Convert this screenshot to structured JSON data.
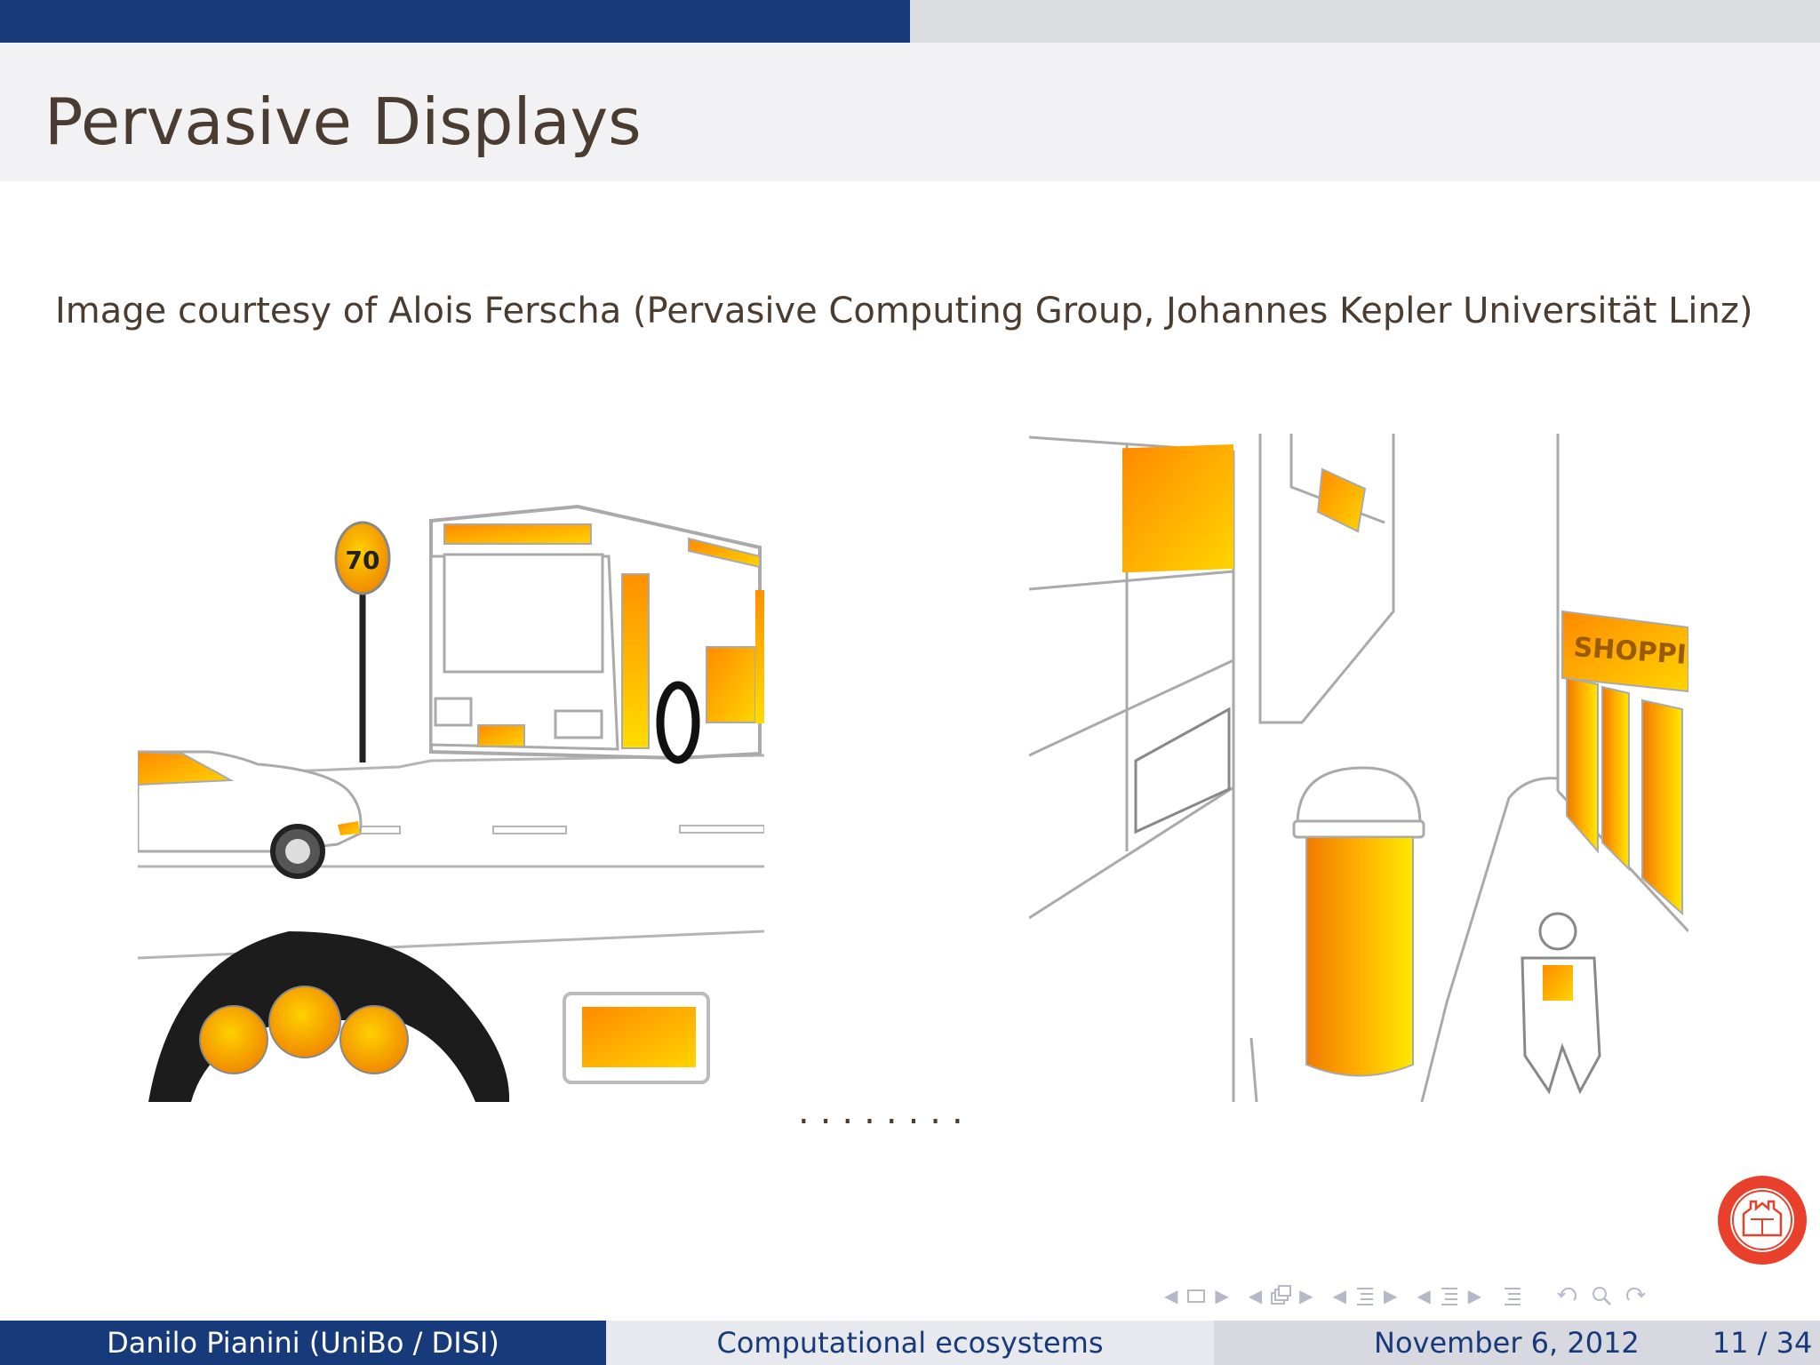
{
  "slide": {
    "title": "Pervasive Displays",
    "caption": "Image courtesy of Alois Ferscha (Pervasive Computing Group, Johannes Kepler Universität Linz)",
    "ellipsis": "........",
    "speed_sign": "70",
    "shop_sign": "SHOPPING",
    "progress_fraction": 0.5
  },
  "footer": {
    "author": "Danilo Pianini  (UniBo / DISI)",
    "talk_title": "Computational ecosystems",
    "date": "November 6, 2012",
    "page": "11 / 34"
  },
  "colors": {
    "navy": "#173a7a",
    "orange": "#f5a000",
    "yellow": "#ffe000",
    "seal_red": "#e8402a",
    "text_brown": "#4a3c30"
  },
  "icons": {
    "logo": "university-seal-icon",
    "nav": [
      "frame-nav-icon",
      "subsection-nav-icon",
      "section-nav-icon",
      "presentation-nav-icon",
      "toc-icon",
      "undo-icon",
      "search-icon",
      "redo-icon"
    ]
  }
}
